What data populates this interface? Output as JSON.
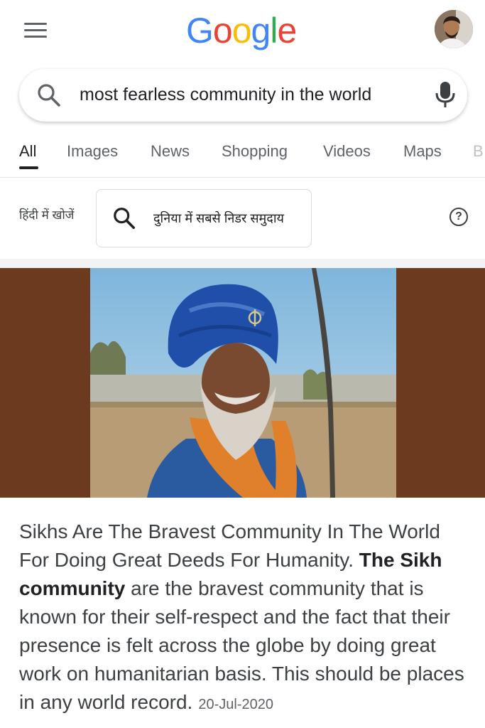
{
  "header": {
    "logo_letters": [
      "G",
      "o",
      "o",
      "g",
      "l",
      "e"
    ]
  },
  "search": {
    "query": "most fearless community in the world"
  },
  "tabs": [
    "All",
    "Images",
    "News",
    "Shopping",
    "Videos",
    "Maps",
    "B"
  ],
  "hindi": {
    "label": "हिंदी में खोजें",
    "query": "दुनिया में सबसे निडर समुदाय",
    "help": "?"
  },
  "snippet": {
    "text_a": "Sikhs Are The Bravest Community In The World For Doing Great Deeds For Humanity. ",
    "bold": "The Sikh community",
    "text_b": " are the bravest community that is known for their self-respect and the fact that their presence is felt across the globe by doing great work on humanitarian basis. This should be places in any world record.",
    "date": "20-Jul-2020"
  },
  "colors": {
    "google_blue": "#4285F4",
    "google_red": "#EA4335",
    "google_yellow": "#FBBC05",
    "google_green": "#34A853",
    "image_frame": "#6b3a1f"
  }
}
